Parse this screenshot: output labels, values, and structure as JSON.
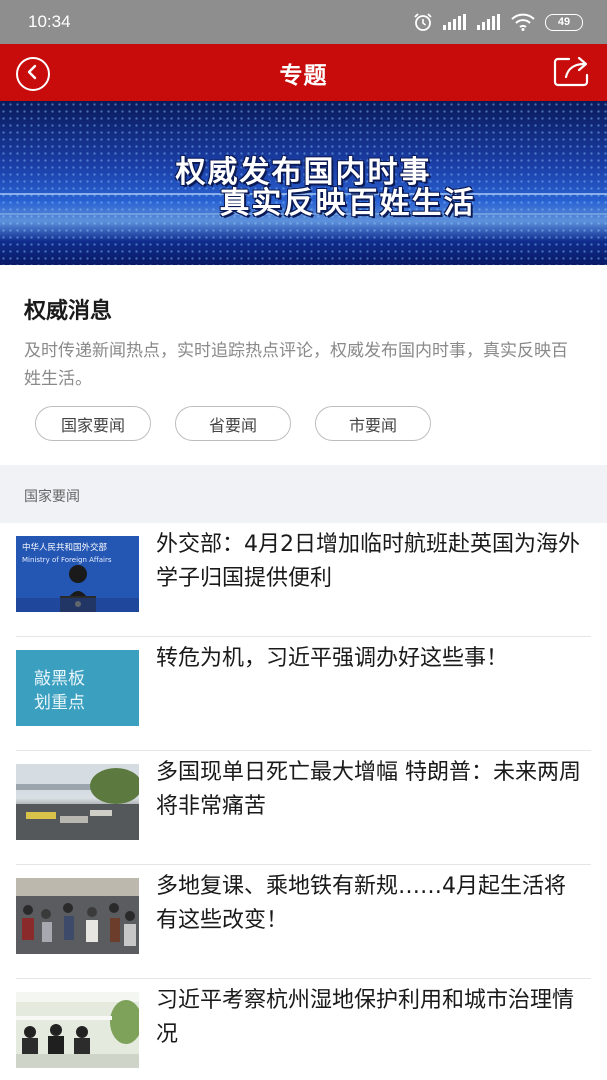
{
  "status_bar": {
    "time": "10:34",
    "battery": "49"
  },
  "nav": {
    "title": "专题"
  },
  "banner": {
    "line1": "权威发布国内时事",
    "line2": "真实反映百姓生活"
  },
  "intro": {
    "title": "权威消息",
    "description": "及时传递新闻热点，实时追踪热点评论，权威发布国内时事，真实反映百姓生活。",
    "tags": [
      "国家要闻",
      "省要闻",
      "市要闻"
    ]
  },
  "section": {
    "label": "国家要闻"
  },
  "news": [
    {
      "title": "外交部：4月2日增加临时航班赴英国为海外学子归国提供便利",
      "thumb_text": "中华人民共和国外交部",
      "thumb_subtext": "Ministry of Foreign Affairs"
    },
    {
      "title": "转危为机，习近平强调办好这些事！",
      "thumb_text": "敲黑板划重点"
    },
    {
      "title": "多国现单日死亡最大增幅 特朗普：未来两周将非常痛苦"
    },
    {
      "title": "多地复课、乘地铁有新规……4月起生活将有这些改变！"
    },
    {
      "title": "习近平考察杭州湿地保护利用和城市治理情况"
    }
  ]
}
